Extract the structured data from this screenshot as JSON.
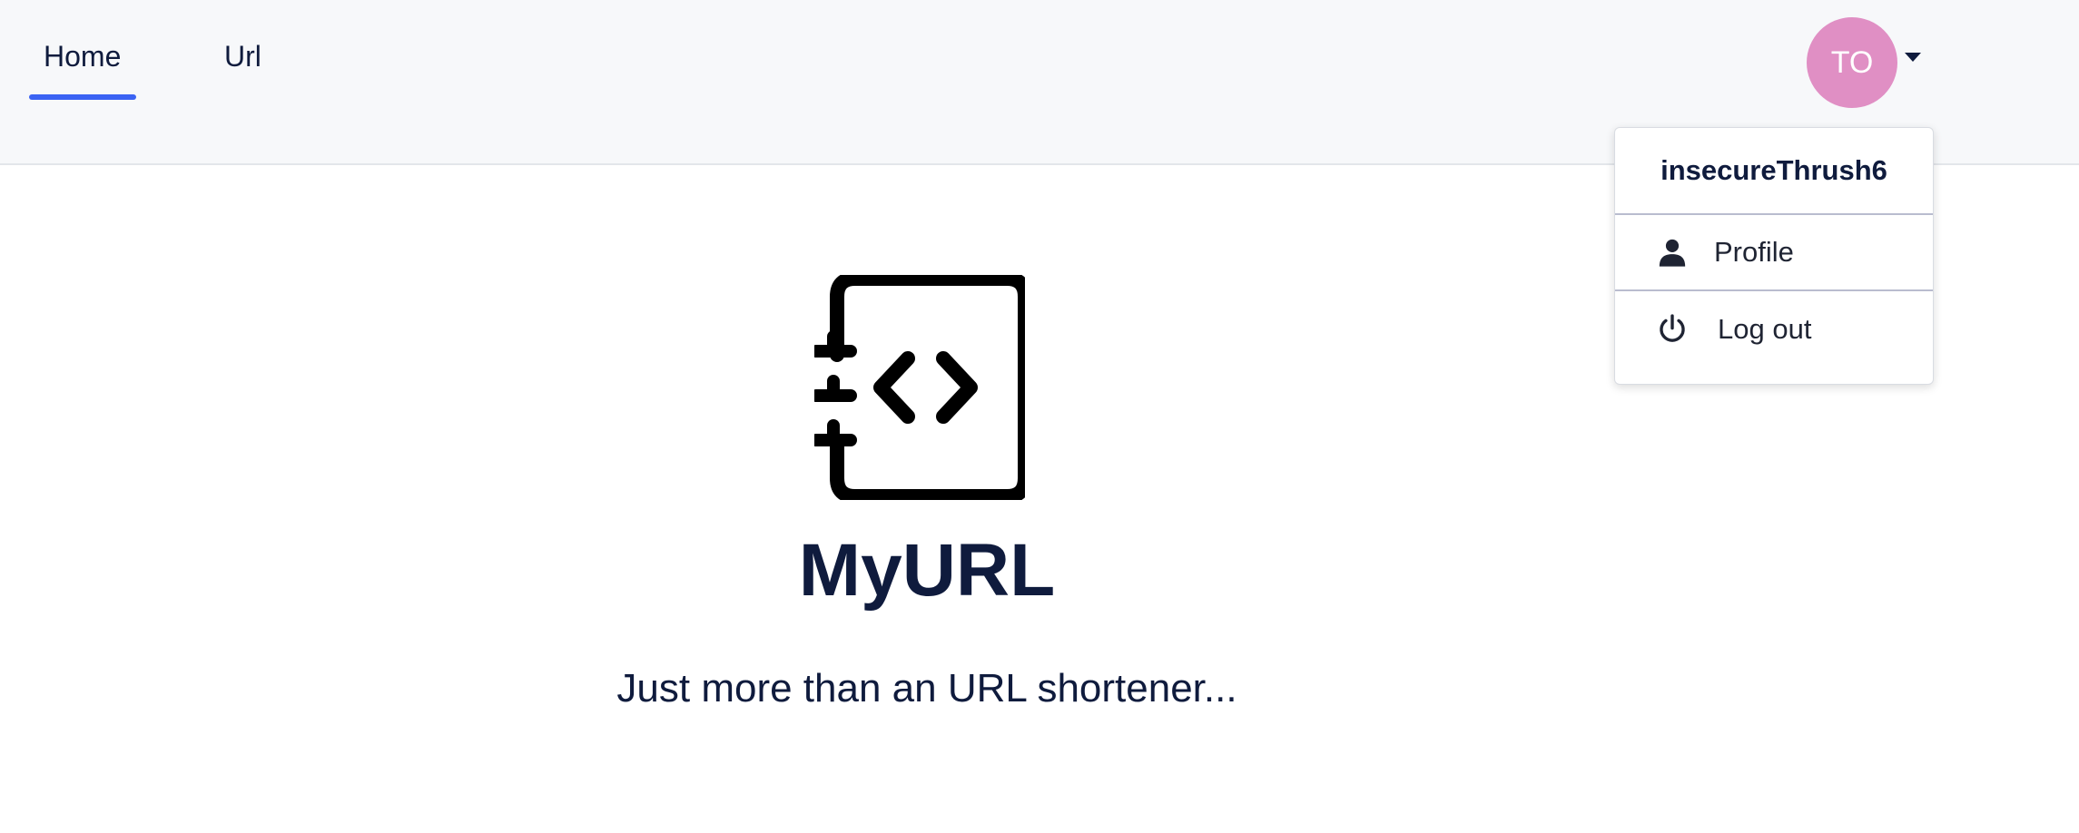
{
  "nav": {
    "tabs": [
      {
        "label": "Home",
        "active": true
      },
      {
        "label": "Url",
        "active": false
      }
    ],
    "active_color": "#3b63f3"
  },
  "user_menu": {
    "avatar_initials": "TO",
    "avatar_color": "#e08fc4",
    "username": "insecureThrush6",
    "items": [
      {
        "label": "Profile",
        "icon": "person-icon"
      },
      {
        "label": "Log out",
        "icon": "power-icon"
      }
    ]
  },
  "hero": {
    "logo_icon": "code-notebook-icon",
    "title": "MyURL",
    "subtitle": "Just more than an URL shortener..."
  }
}
